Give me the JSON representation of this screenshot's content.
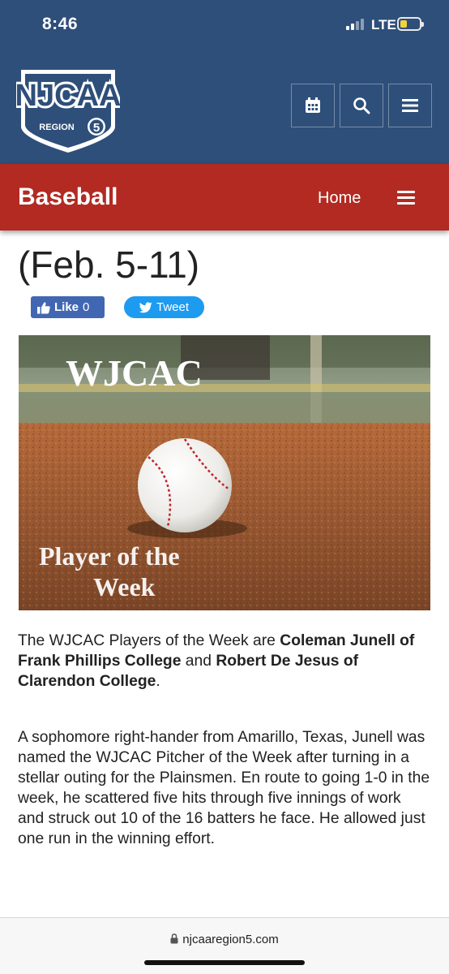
{
  "status_bar": {
    "time": "8:46",
    "network": "LTE",
    "battery_level": 0.35
  },
  "header": {
    "logo_text": "NJCAA",
    "logo_region_label": "REGION",
    "logo_region_number": "5",
    "icons": [
      "calendar-icon",
      "search-icon",
      "menu-icon"
    ]
  },
  "subnav": {
    "title": "Baseball",
    "home_label": "Home"
  },
  "article": {
    "headline_line": "(Feb. 5-11)",
    "like_label": "Like",
    "like_count": "0",
    "tweet_label": "Tweet",
    "hero": {
      "line1": "WJCAC",
      "line2": "Player of the",
      "line3": "Week"
    },
    "p1": {
      "t1": "The WJCAC Players of the Week are ",
      "b1": "Coleman Junell of Frank Phillips College",
      "t2": " and ",
      "b2": "Robert De Jesus of Clarendon College",
      "t3": "."
    },
    "p2": "A sophomore right-hander from Amarillo, Texas, Junell was named the WJCAC Pitcher of the Week after turning in a stellar outing for the Plainsmen. En route to going 1-0 in the week, he scattered five hits through five innings of work and struck out 10 of the 16 batters he face. He allowed just one run in the winning effort."
  },
  "browser": {
    "url": "njcaaregion5.com"
  },
  "colors": {
    "header_navy": "#2e4f7a",
    "subnav_red": "#b22a22",
    "facebook_blue": "#4267b2",
    "twitter_blue": "#1d9bf0"
  }
}
